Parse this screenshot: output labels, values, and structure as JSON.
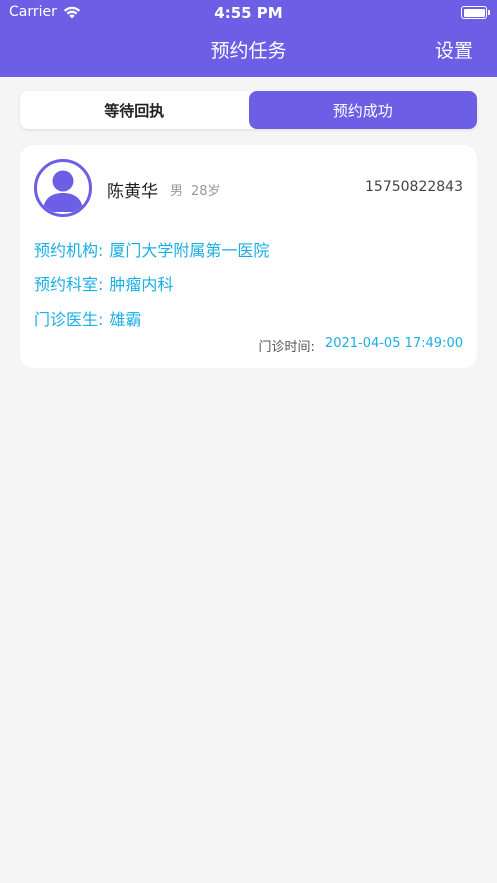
{
  "status_bar": {
    "carrier": "Carrier",
    "time": "4:55 PM"
  },
  "nav": {
    "title": "预约任务",
    "settings_label": "设置"
  },
  "tabs": [
    {
      "label": "等待回执",
      "active": false
    },
    {
      "label": "预约成功",
      "active": true
    }
  ],
  "appointment": {
    "name": "陈黄华",
    "gender": "男",
    "age": "28岁",
    "phone": "15750822843",
    "institution_label": "预约机构:",
    "institution": "厦门大学附属第一医院",
    "department_label": "预约科室:",
    "department": "肿瘤内科",
    "doctor_label": "门诊医生:",
    "doctor": "雄霸",
    "time_label": "门诊时间:",
    "time": "2021-04-05 17:49:00"
  },
  "colors": {
    "accent": "#6c5fe6",
    "info_text": "#1aaee5",
    "background": "#f5f5f5"
  }
}
